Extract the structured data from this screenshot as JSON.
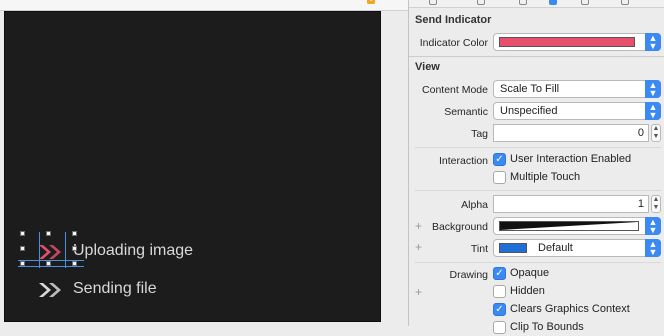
{
  "canvas": {
    "cells": [
      {
        "label": "Uploading image",
        "icon": "double-chevron-right-icon",
        "icon_color": "#e0506a"
      },
      {
        "label": "Sending file",
        "icon": "double-chevron-right-icon",
        "icon_color": "#d8d8d8"
      }
    ]
  },
  "inspector": {
    "send_indicator": {
      "title": "Send Indicator",
      "indicator_color_label": "Indicator Color",
      "indicator_color": "#e84f6c"
    },
    "view": {
      "title": "View",
      "content_mode_label": "Content Mode",
      "content_mode_value": "Scale To Fill",
      "semantic_label": "Semantic",
      "semantic_value": "Unspecified",
      "tag_label": "Tag",
      "tag_value": "0",
      "interaction_label": "Interaction",
      "user_interaction_label": "User Interaction Enabled",
      "user_interaction_checked": true,
      "multiple_touch_label": "Multiple Touch",
      "multiple_touch_checked": false,
      "alpha_label": "Alpha",
      "alpha_value": "1",
      "background_label": "Background",
      "tint_label": "Tint",
      "tint_value": "Default",
      "tint_color": "#1f6fd6",
      "drawing_label": "Drawing",
      "opaque_label": "Opaque",
      "opaque_checked": true,
      "hidden_label": "Hidden",
      "hidden_checked": false,
      "clears_graphics_label": "Clears Graphics Context",
      "clears_graphics_checked": true,
      "clip_label": "Clip To Bounds"
    }
  },
  "colors": {
    "accent": "#3b89f2",
    "canvas_background": "#1c1c1c",
    "selection_guide": "#4a90e2"
  }
}
